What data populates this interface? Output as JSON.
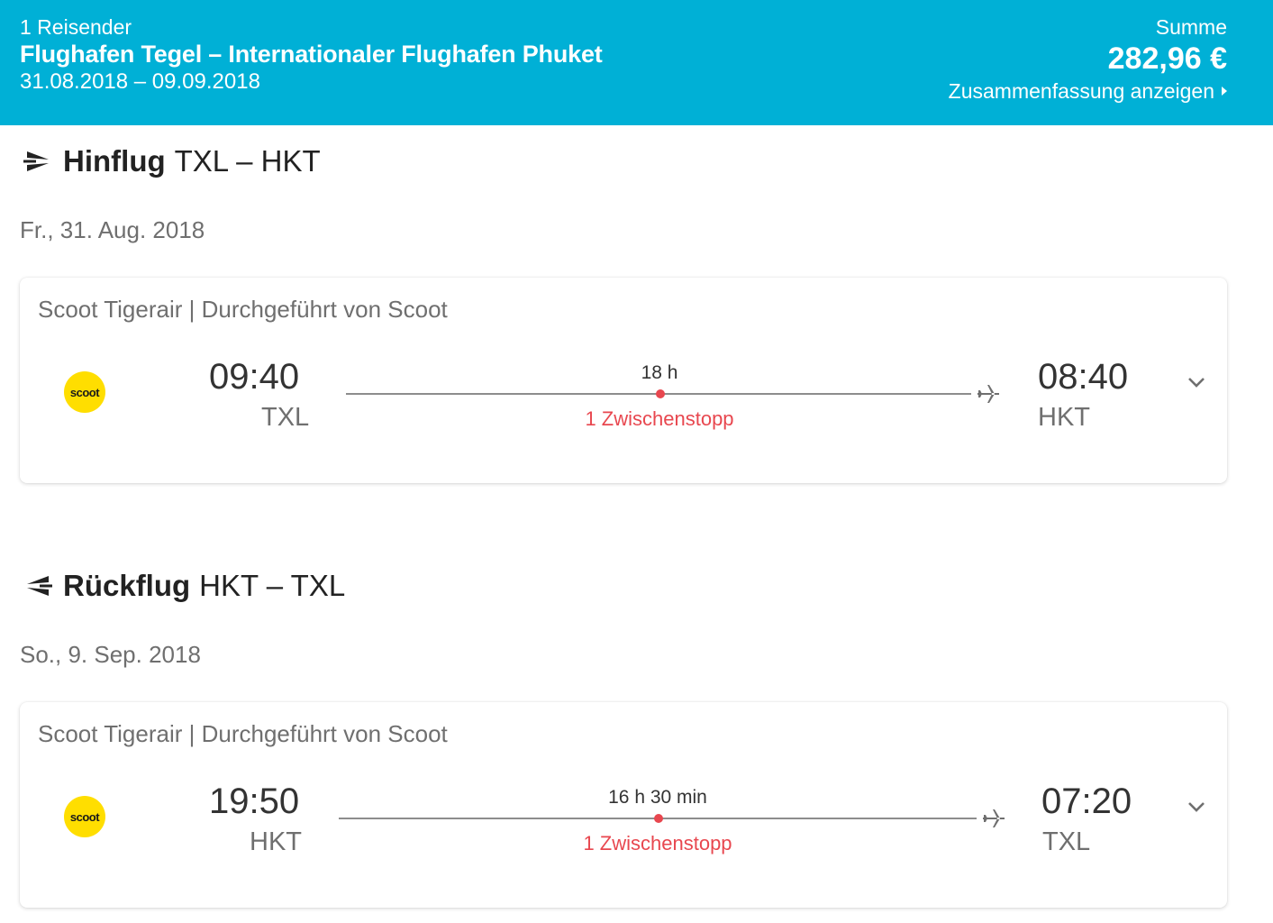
{
  "header": {
    "travellers": "1 Reisender",
    "route": "Flughafen Tegel – Internationaler Flughafen Phuket",
    "dates": "31.08.2018 – 09.09.2018",
    "sum_label": "Summe",
    "sum_value": "282,96 €",
    "summary_link": "Zusammenfassung anzeigen"
  },
  "outbound": {
    "title_bold": "Hinflug",
    "title_route": "TXL – HKT",
    "date": "Fr., 31. Aug. 2018",
    "carrier": "Scoot Tigerair | Durchgeführt von Scoot",
    "logo_text": "scoot",
    "dep_time": "09:40",
    "dep_code": "TXL",
    "duration": "18 h",
    "stops": "1 Zwischenstopp",
    "arr_time": "08:40",
    "arr_code": "HKT"
  },
  "inbound": {
    "title_bold": "Rückflug",
    "title_route": "HKT – TXL",
    "date": "So., 9. Sep. 2018",
    "carrier": "Scoot Tigerair | Durchgeführt von Scoot",
    "logo_text": "scoot",
    "dep_time": "19:50",
    "dep_code": "HKT",
    "duration": "16 h 30 min",
    "stops": "1 Zwischenstopp",
    "arr_time": "07:20",
    "arr_code": "TXL"
  },
  "colors": {
    "header_bg": "#00b0d6",
    "stop_red": "#e8474f",
    "scoot_yellow": "#ffde00"
  },
  "icons": {
    "outbound": "plane-departure-icon",
    "inbound": "plane-return-icon",
    "plane": "airplane-icon",
    "expand": "chevron-down-icon",
    "link": "triangle-right-icon"
  }
}
